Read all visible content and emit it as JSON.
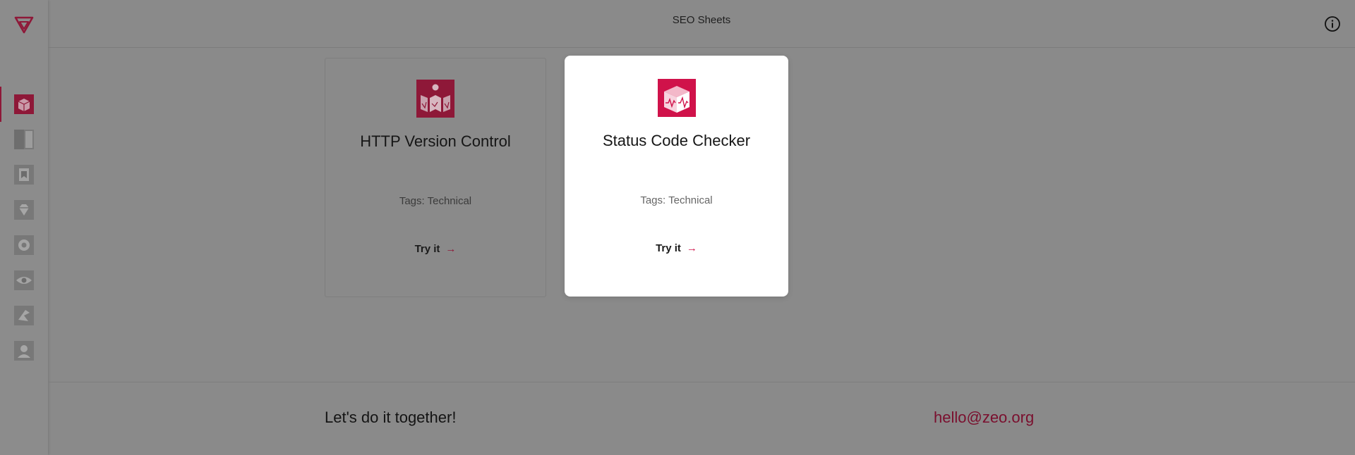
{
  "header": {
    "title": "SEO Sheets"
  },
  "sidebar": {
    "items": [
      {
        "icon": "http-version-cube-icon",
        "active": true
      },
      {
        "icon": "sheet-panel-icon",
        "active": false
      },
      {
        "icon": "page-stack-icon",
        "active": false
      },
      {
        "icon": "diamond-gem-icon",
        "active": false
      },
      {
        "icon": "gear-badge-icon",
        "active": false
      },
      {
        "icon": "eye-view-icon",
        "active": false
      },
      {
        "icon": "puzzle-arrow-icon",
        "active": false
      },
      {
        "icon": "person-circle-icon",
        "active": false
      }
    ]
  },
  "cards": [
    {
      "title": "HTTP Version Control",
      "tags_label": "Tags:",
      "tags": "Technical",
      "cta": "Try it",
      "icon": "http-version-cube-icon"
    },
    {
      "title": "Status Code Checker",
      "tags_label": "Tags:",
      "tags": "Technical",
      "cta": "Try it",
      "icon": "status-code-cube-icon"
    }
  ],
  "footer": {
    "tagline": "Let's do it together!",
    "email": "hello@zeo.org"
  },
  "colors": {
    "brand": "#8e1838",
    "accent": "#d0124a",
    "overlay": "#8a8a8a",
    "card_bg": "#ffffff"
  }
}
